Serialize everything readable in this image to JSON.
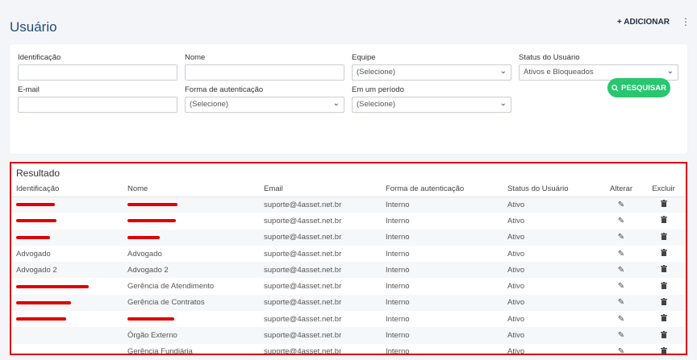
{
  "header": {
    "title": "Usuário",
    "add_label": "+ ADICIONAR",
    "menu_glyph": "⋮"
  },
  "filters": {
    "identificacao": {
      "label": "Identificação",
      "value": ""
    },
    "nome": {
      "label": "Nome",
      "value": ""
    },
    "equipe": {
      "label": "Equipe",
      "value": "(Selecione)"
    },
    "status": {
      "label": "Status do Usuário",
      "value": "Ativos e Bloqueados"
    },
    "email": {
      "label": "E-mail",
      "value": ""
    },
    "forma": {
      "label": "Forma de autenticação",
      "value": "(Selecione)"
    },
    "periodo": {
      "label": "Em um período",
      "value": "(Selecione)"
    },
    "search_label": "PESQUISAR"
  },
  "result": {
    "title": "Resultado",
    "columns": [
      "Identificação",
      "Nome",
      "Email",
      "Forma de autenticação",
      "Status do Usuário",
      "Alterar",
      "Excluir"
    ],
    "rows": [
      {
        "id": "",
        "nome": "",
        "email": "suporte@4asset.net.br",
        "forma": "Interno",
        "status": "Ativo"
      },
      {
        "id": "",
        "nome": "",
        "email": "suporte@4asset.net.br",
        "forma": "Interno",
        "status": "Ativo"
      },
      {
        "id": "",
        "nome": "",
        "email": "suporte@4asset.net.br",
        "forma": "Interno",
        "status": "Ativo"
      },
      {
        "id": "Advogado",
        "nome": "Advogado",
        "email": "suporte@4asset.net.br",
        "forma": "Interno",
        "status": "Ativo"
      },
      {
        "id": "Advogado 2",
        "nome": "Advogado 2",
        "email": "suporte@4asset.net.br",
        "forma": "Interno",
        "status": "Ativo"
      },
      {
        "id": "",
        "nome": "Gerência de Atendimento",
        "email": "suporte@4asset.net.br",
        "forma": "Interno",
        "status": "Ativo"
      },
      {
        "id": "",
        "nome": "Gerência de Contratos",
        "email": "suporte@4asset.net.br",
        "forma": "Interno",
        "status": "Ativo"
      },
      {
        "id": "",
        "nome": "",
        "email": "suporte@4asset.net.br",
        "forma": "Interno",
        "status": "Ativo"
      },
      {
        "id": "",
        "nome": "Órgão Externo",
        "email": "suporte@4asset.net.br",
        "forma": "Interno",
        "status": "Ativo"
      },
      {
        "id": "",
        "nome": "Gerência Fundiária",
        "email": "suporte@4asset.net.br",
        "forma": "Interno",
        "status": "Ativo"
      }
    ]
  },
  "icons": {
    "edit": "edit-icon",
    "delete": "trash-icon",
    "search": "search-icon"
  },
  "colors": {
    "accent_green": "#28c76f",
    "highlight_red": "#e00000",
    "title_blue": "#1f4e79"
  }
}
